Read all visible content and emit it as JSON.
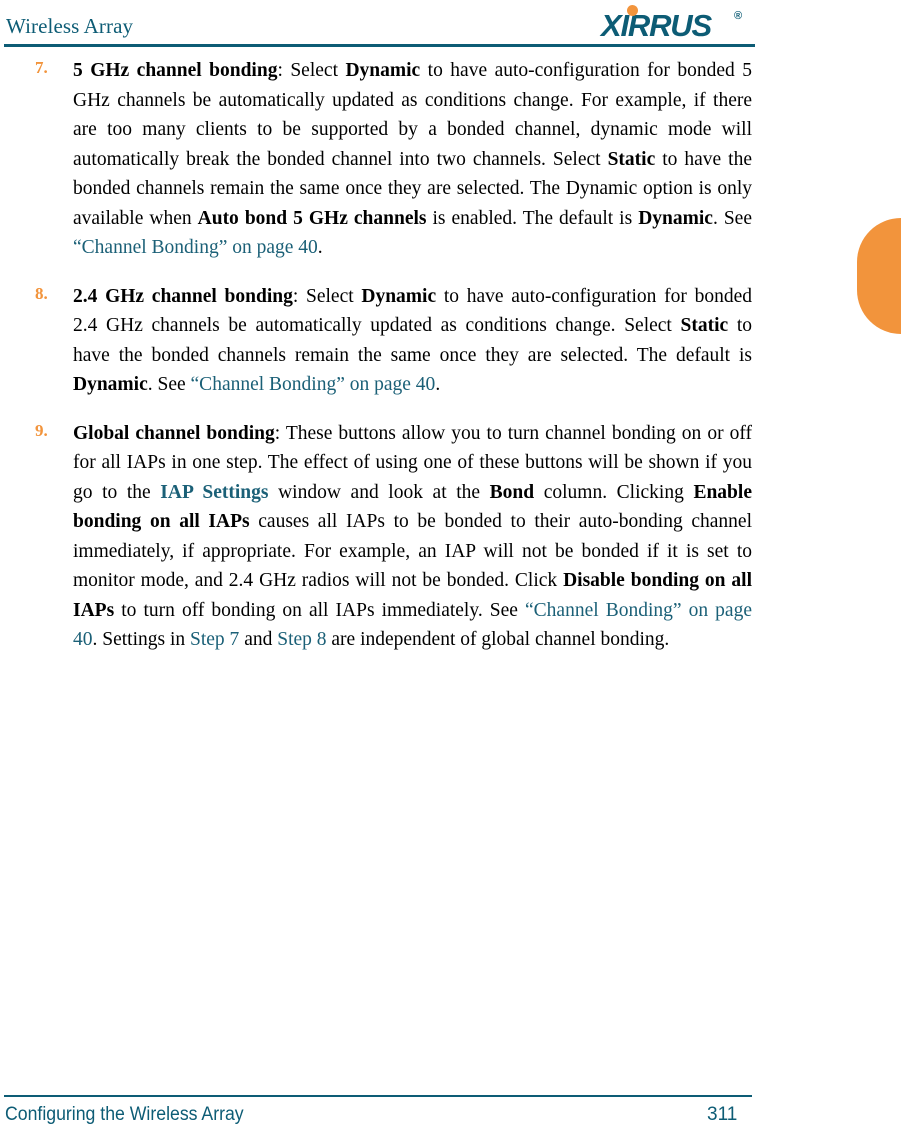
{
  "header": {
    "title": "Wireless Array",
    "logo": {
      "word": "XIRRUS",
      "trademark": "®",
      "dot_icon": "orange-dot-icon"
    }
  },
  "colors": {
    "teal": "#0d5c75",
    "link_teal": "#1b6077",
    "orange": "#f2943c",
    "body_text": "#000000",
    "page_background": "#ffffff"
  },
  "edge_tab": {
    "shape": "half-circle-tab",
    "color": "#f2943c"
  },
  "steps": [
    {
      "number": "7.",
      "segments": [
        {
          "text": "5 GHz channel bonding",
          "style": "bold"
        },
        {
          "text": ": Select ",
          "style": "normal"
        },
        {
          "text": "Dynamic",
          "style": "bold"
        },
        {
          "text": " to have auto-configuration for bonded 5 GHz channels be automatically updated as conditions change. For example, if there are too many clients to be supported by a bonded channel, dynamic mode will automatically break the bonded channel into two channels. Select ",
          "style": "normal"
        },
        {
          "text": "Static",
          "style": "bold"
        },
        {
          "text": " to have the bonded channels remain the same once they are selected. The Dynamic option is only available when ",
          "style": "normal"
        },
        {
          "text": "Auto bond 5 GHz channels",
          "style": "bold"
        },
        {
          "text": " is enabled. The default is ",
          "style": "normal"
        },
        {
          "text": "Dynamic",
          "style": "bold"
        },
        {
          "text": ". See ",
          "style": "normal"
        },
        {
          "text": "“Channel Bonding” on page 40",
          "style": "link"
        },
        {
          "text": ".",
          "style": "normal"
        }
      ]
    },
    {
      "number": "8.",
      "segments": [
        {
          "text": "2.4 GHz channel bonding",
          "style": "bold"
        },
        {
          "text": ": Select ",
          "style": "normal"
        },
        {
          "text": "Dynamic",
          "style": "bold"
        },
        {
          "text": " to have auto-configuration for bonded 2.4 GHz channels be automatically updated as conditions change. Select ",
          "style": "normal"
        },
        {
          "text": "Static",
          "style": "bold"
        },
        {
          "text": " to have the bonded channels remain the same once they are selected. The default is ",
          "style": "normal"
        },
        {
          "text": "Dynamic",
          "style": "bold"
        },
        {
          "text": ". See ",
          "style": "normal"
        },
        {
          "text": "“Channel Bonding” on page 40",
          "style": "link"
        },
        {
          "text": ".",
          "style": "normal"
        }
      ]
    },
    {
      "number": "9.",
      "segments": [
        {
          "text": "Global channel bonding",
          "style": "bold"
        },
        {
          "text": ": These buttons allow you to turn channel bonding on or off for all IAPs in one step. The effect of using one of these buttons will be shown if you go to the ",
          "style": "normal"
        },
        {
          "text": "IAP Settings",
          "style": "link-bold"
        },
        {
          "text": " window and look at the ",
          "style": "normal"
        },
        {
          "text": "Bond",
          "style": "bold"
        },
        {
          "text": " column. Clicking ",
          "style": "normal"
        },
        {
          "text": "Enable bonding on all IAPs",
          "style": "bold"
        },
        {
          "text": " causes all IAPs to be bonded to their auto-bonding channel immediately, if appropriate. For example, an IAP will not be bonded if it is set to monitor mode, and 2.4 GHz radios will not be bonded. Click ",
          "style": "normal"
        },
        {
          "text": "Disable bonding on all IAPs",
          "style": "bold"
        },
        {
          "text": " to turn off bonding on all IAPs immediately. See ",
          "style": "normal"
        },
        {
          "text": "“Channel Bonding” on page 40",
          "style": "link"
        },
        {
          "text": ". Settings in ",
          "style": "normal"
        },
        {
          "text": "Step 7",
          "style": "link"
        },
        {
          "text": " and ",
          "style": "normal"
        },
        {
          "text": "Step 8",
          "style": "link"
        },
        {
          "text": " are independent of global channel bonding.",
          "style": "normal"
        }
      ]
    }
  ],
  "footer": {
    "left_text": "Configuring the Wireless Array",
    "page_number": "311"
  }
}
